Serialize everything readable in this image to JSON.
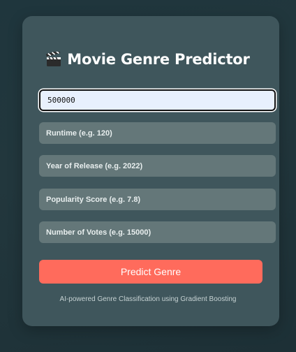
{
  "app": {
    "title": "Movie Genre Predictor",
    "title_icon": "clapperboard-icon"
  },
  "form": {
    "budget_value": "500000",
    "runtime_placeholder": "Runtime (e.g. 120)",
    "year_placeholder": "Year of Release (e.g. 2022)",
    "popularity_placeholder": "Popularity Score (e.g. 7.8)",
    "votes_placeholder": "Number of Votes (e.g. 15000)",
    "submit_label": "Predict Genre"
  },
  "footer": {
    "text": "AI-powered Genre Classification using Gradient Boosting"
  },
  "colors": {
    "background": "#22373d",
    "card": "#3f565c",
    "input": "#647779",
    "input_active": "#e8f0fd",
    "accent": "#ff6b5c"
  }
}
